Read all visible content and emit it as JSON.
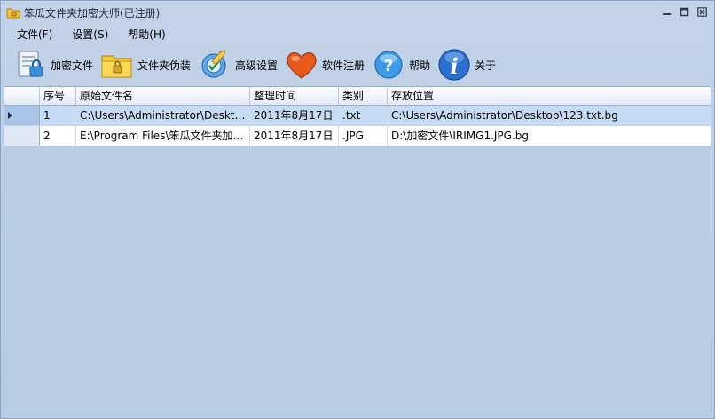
{
  "window": {
    "title": "笨瓜文件夹加密大师(已注册)"
  },
  "menu": {
    "items": [
      {
        "label": "文件(F)"
      },
      {
        "label": "设置(S)"
      },
      {
        "label": "帮助(H)"
      }
    ]
  },
  "toolbar": {
    "items": [
      {
        "label": "加密文件",
        "icon": "encrypt-file-icon"
      },
      {
        "label": "文件夹伪装",
        "icon": "folder-disguise-icon"
      },
      {
        "label": "高级设置",
        "icon": "advanced-settings-icon"
      },
      {
        "label": "软件注册",
        "icon": "heart-icon"
      },
      {
        "label": "帮助",
        "icon": "help-icon"
      },
      {
        "label": "关于",
        "icon": "info-icon"
      }
    ]
  },
  "grid": {
    "columns": [
      "序号",
      "原始文件名",
      "整理时间",
      "类别",
      "存放位置"
    ],
    "rows": [
      {
        "index": "1",
        "filename": "C:\\Users\\Administrator\\Desktop\\...",
        "time": "2011年8月17日",
        "type": ".txt",
        "location": "C:\\Users\\Administrator\\Desktop\\123.txt.bg",
        "selected": true
      },
      {
        "index": "2",
        "filename": "E:\\Program Files\\笨瓜文件夹加密...",
        "time": "2011年8月17日",
        "type": ".JPG",
        "location": "D:\\加密文件\\IRIMG1.JPG.bg",
        "selected": false
      }
    ]
  },
  "colors": {
    "background": "#bccfe6",
    "selected_row": "#c6dcf5",
    "accent": "#2e6fd1"
  }
}
